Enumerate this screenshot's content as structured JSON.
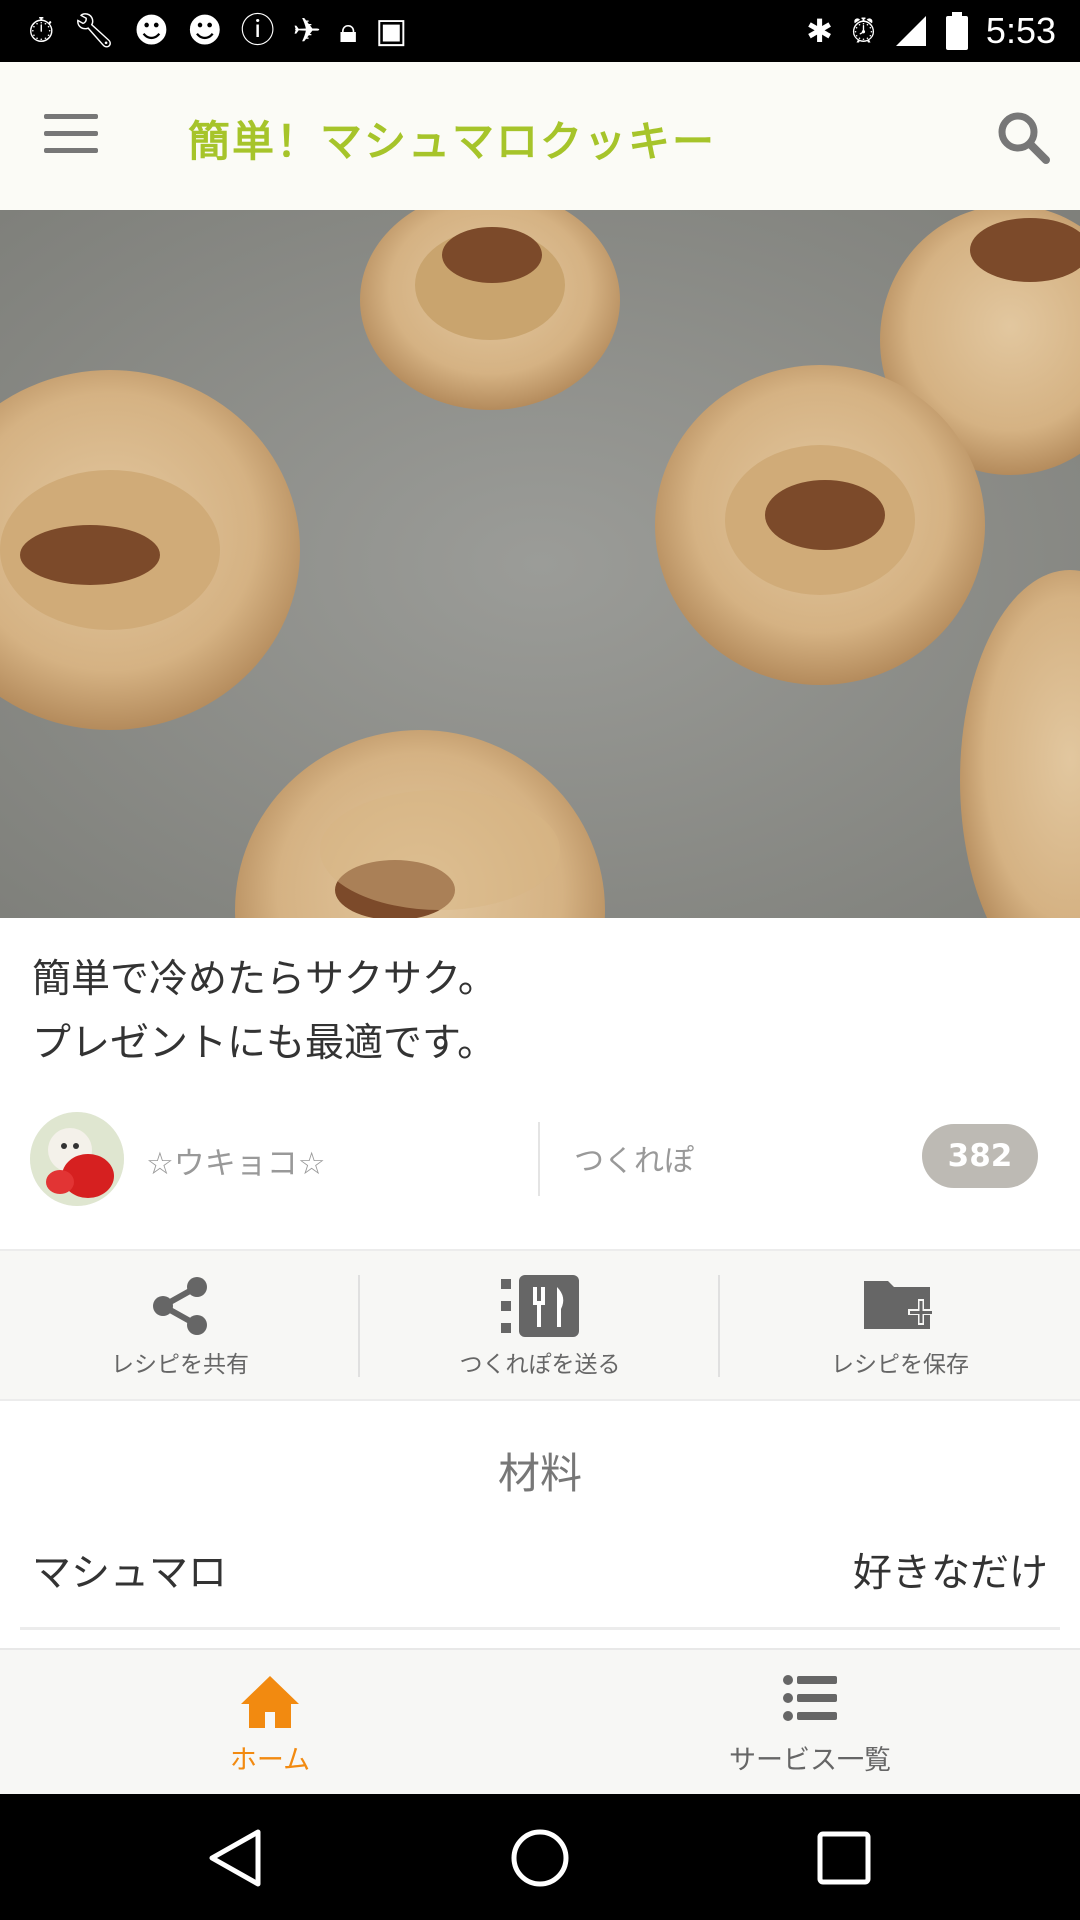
{
  "status_bar": {
    "time": "5:53",
    "left_icons": [
      "stopwatch-icon",
      "wrench-icon",
      "smiley-icon",
      "smiley-icon",
      "info-icon",
      "satellite-icon",
      "lock-icon",
      "android-icon"
    ],
    "right_icons": [
      "bluetooth-icon",
      "alarm-icon",
      "signal-icon",
      "battery-icon"
    ]
  },
  "app_bar": {
    "title": "簡単！マシュマロクッキー",
    "title_color": "#a6c42a"
  },
  "recipe": {
    "description_lines": [
      "簡単で冷めたらサクサク。",
      "プレゼントにも最適です。"
    ],
    "author": "☆ウキョコ☆",
    "tsukurepo_label": "つくれぽ",
    "tsukurepo_count": "382"
  },
  "actions": [
    {
      "label": "レシピを共有",
      "icon": "share-icon"
    },
    {
      "label": "つくれぽを送る",
      "icon": "cutlery-icon"
    },
    {
      "label": "レシピを保存",
      "icon": "folder-add-icon"
    }
  ],
  "ingredients": {
    "header": "材料",
    "items": [
      {
        "name": "マシュマロ",
        "amount": "好きなだけ"
      }
    ]
  },
  "bottom_nav": {
    "tabs": [
      {
        "label": "ホーム",
        "icon": "home-icon",
        "active": true
      },
      {
        "label": "サービス一覧",
        "icon": "list-icon",
        "active": false
      }
    ],
    "active_color": "#f28a10",
    "inactive_color": "#666666"
  }
}
